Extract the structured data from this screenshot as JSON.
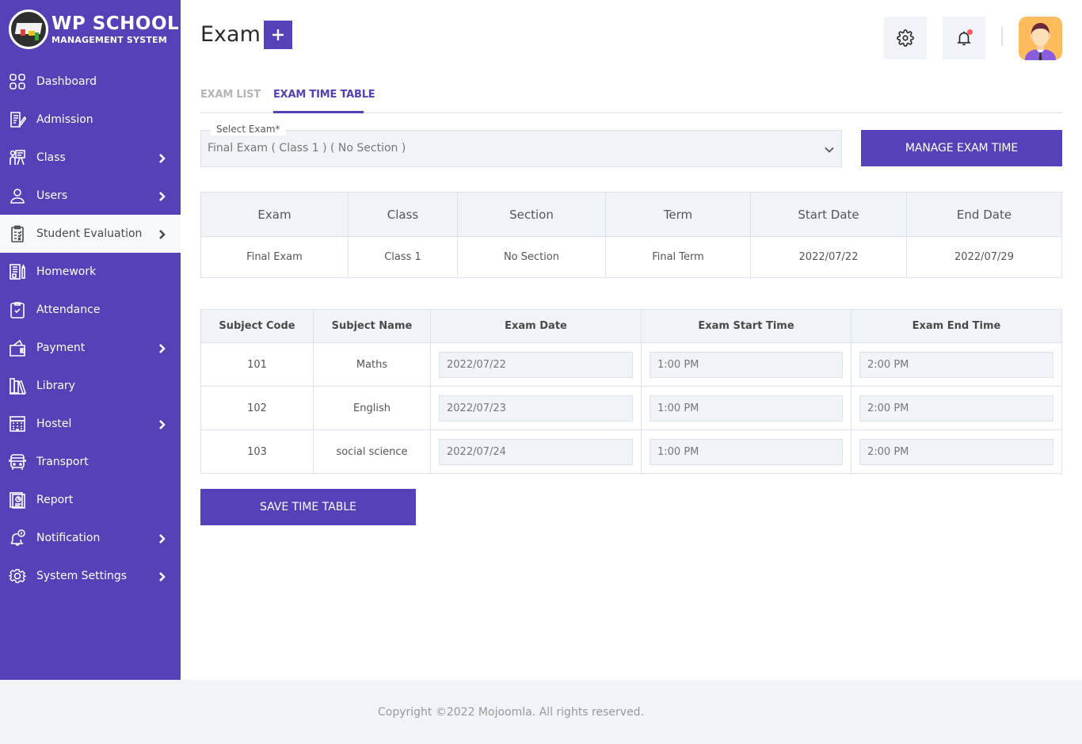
{
  "brand": {
    "title": "WP SCHOOL",
    "subtitle": "MANAGEMENT SYSTEM"
  },
  "sidebar": {
    "items": [
      {
        "label": "Dashboard",
        "icon": "dashboard-grid-icon",
        "has_submenu": false,
        "active": false
      },
      {
        "label": "Admission",
        "icon": "admission-form-icon",
        "has_submenu": false,
        "active": false
      },
      {
        "label": "Class",
        "icon": "class-teacher-icon",
        "has_submenu": true,
        "active": false
      },
      {
        "label": "Users",
        "icon": "user-icon",
        "has_submenu": true,
        "active": false
      },
      {
        "label": "Student Evaluation",
        "icon": "clipboard-checklist-icon",
        "has_submenu": true,
        "active": true
      },
      {
        "label": "Homework",
        "icon": "homework-notebook-icon",
        "has_submenu": false,
        "active": false
      },
      {
        "label": "Attendance",
        "icon": "clipboard-check-icon",
        "has_submenu": false,
        "active": false
      },
      {
        "label": "Payment",
        "icon": "wallet-icon",
        "has_submenu": true,
        "active": false
      },
      {
        "label": "Library",
        "icon": "books-icon",
        "has_submenu": false,
        "active": false
      },
      {
        "label": "Hostel",
        "icon": "building-icon",
        "has_submenu": true,
        "active": false
      },
      {
        "label": "Transport",
        "icon": "bus-icon",
        "has_submenu": false,
        "active": false
      },
      {
        "label": "Report",
        "icon": "report-icon",
        "has_submenu": false,
        "active": false
      },
      {
        "label": "Notification",
        "icon": "bell-notification-icon",
        "has_submenu": true,
        "active": false
      },
      {
        "label": "System Settings",
        "icon": "gear-icon",
        "has_submenu": true,
        "active": false
      }
    ]
  },
  "header": {
    "title": "Exam",
    "add_icon": "plus-icon",
    "settings_icon": "gear-icon",
    "notification_icon": "bell-icon",
    "has_unread_notification": true
  },
  "tabs": [
    {
      "label": "EXAM LIST",
      "active": false
    },
    {
      "label": "EXAM TIME TABLE",
      "active": true
    }
  ],
  "exam_select": {
    "label": "Select Exam*",
    "value": "Final Exam ( Class 1 ) ( No Section )"
  },
  "manage_button": "MANAGE EXAM TIME",
  "exam_info": {
    "headers": [
      "Exam",
      "Class",
      "Section",
      "Term",
      "Start Date",
      "End Date"
    ],
    "row": [
      "Final Exam",
      "Class 1",
      "No Section",
      "Final Term",
      "2022/07/22",
      "2022/07/29"
    ]
  },
  "timetable": {
    "headers": [
      "Subject Code",
      "Subject Name",
      "Exam Date",
      "Exam Start Time",
      "Exam End Time"
    ],
    "rows": [
      {
        "code": "101",
        "name": "Maths",
        "date": "2022/07/22",
        "start": "1:00 PM",
        "end": "2:00 PM"
      },
      {
        "code": "102",
        "name": "English",
        "date": "2022/07/23",
        "start": "1:00 PM",
        "end": "2:00 PM"
      },
      {
        "code": "103",
        "name": "social science",
        "date": "2022/07/24",
        "start": "1:00 PM",
        "end": "2:00 PM"
      }
    ]
  },
  "save_button": "SAVE TIME TABLE",
  "footer": {
    "text": "Copyright ©2022 Mojoomla. All rights reserved."
  },
  "colors": {
    "primary": "#5840b8",
    "panel": "#f0f3f8",
    "notification_dot": "#ff5a5a"
  }
}
